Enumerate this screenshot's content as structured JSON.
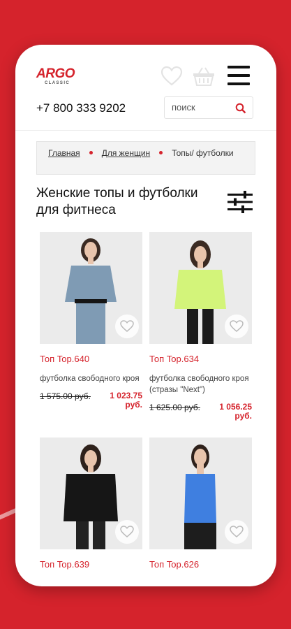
{
  "colors": {
    "accent": "#d5232c",
    "background": "#d5232c"
  },
  "header": {
    "logo_text": "ARGO",
    "logo_subtext": "CLASSIC",
    "phone": "+7 800 333 9202",
    "icons": [
      "heart-icon",
      "basket-icon",
      "menu-icon",
      "search-icon",
      "filter-icon"
    ]
  },
  "search": {
    "placeholder": "поиск"
  },
  "breadcrumb": {
    "items": [
      "Главная",
      "Для женщин"
    ],
    "current": "Топы/ футболки"
  },
  "page": {
    "title": "Женские топы и футболки для фитнеса"
  },
  "products": [
    {
      "name": "Топ Top.640",
      "desc": "футболка свободного кроя",
      "old_price": "1 575.00 руб.",
      "new_price": "1 023.75 руб.",
      "color": "#7f9bb4"
    },
    {
      "name": "Топ Top.634",
      "desc": "футболка свободного кроя (стразы \"Next\")",
      "old_price": "1 625.00 руб.",
      "new_price": "1 056.25 руб.",
      "color": "#d3f47a"
    },
    {
      "name": "Топ Top.639",
      "desc": "",
      "old_price": "",
      "new_price": "",
      "color": "#161616"
    },
    {
      "name": "Топ Top.626",
      "desc": "",
      "old_price": "",
      "new_price": "",
      "color": "#3f7fe0"
    }
  ]
}
